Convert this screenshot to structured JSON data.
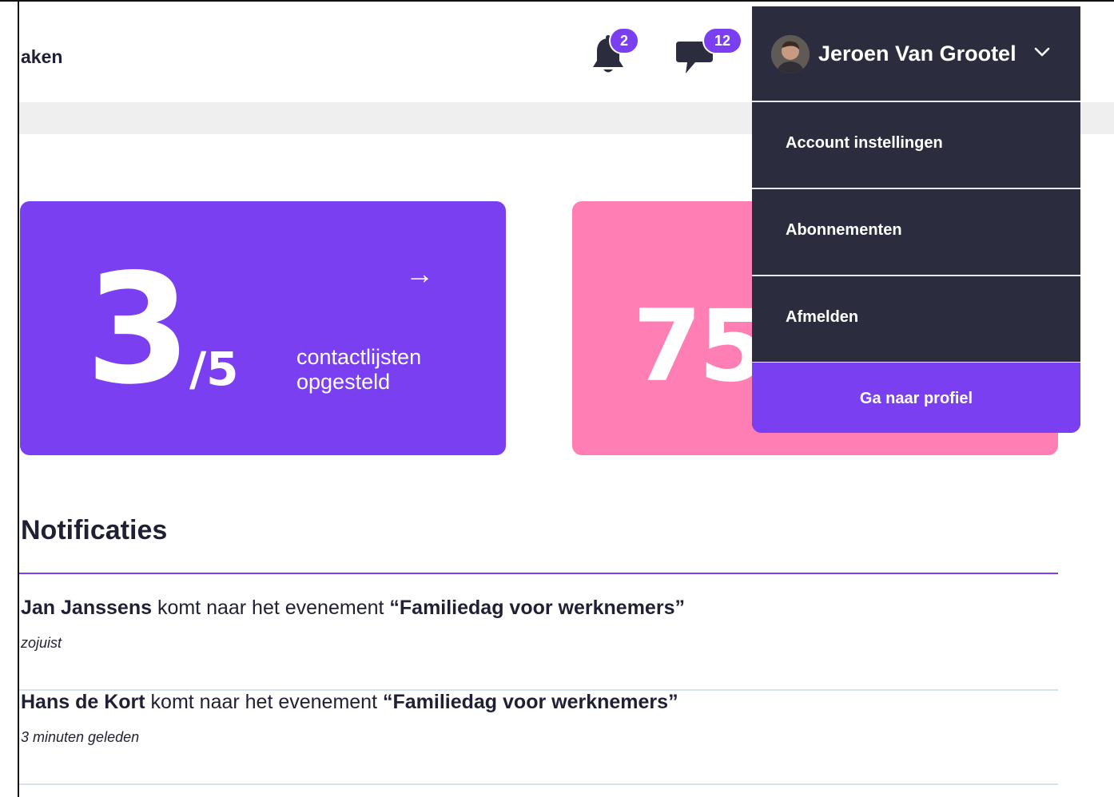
{
  "header": {
    "breadcrumb": "aken",
    "notifications": {
      "icon": "bell-icon",
      "count": "2"
    },
    "messages": {
      "icon": "chat-bubble-icon",
      "count": "12"
    }
  },
  "user_menu": {
    "user_name": "Jeroen Van Grootel",
    "items": [
      {
        "label": "Account instellingen"
      },
      {
        "label": "Abonnementen"
      },
      {
        "label": "Afmelden"
      }
    ],
    "cta_label": "Ga naar profiel"
  },
  "stats": [
    {
      "value": "3",
      "total": "/5",
      "label_line1": "contactlijsten",
      "label_line2": "opgesteld",
      "color": "#7b3ff2",
      "arrow": "→"
    },
    {
      "value": "75",
      "color": "#ff7fb5"
    }
  ],
  "notifications_section": {
    "title": "Notificaties",
    "items": [
      {
        "name": "Jan Janssens",
        "text": " komt naar het evenement ",
        "event": "“Familiedag voor werknemers”",
        "time": "zojuist"
      },
      {
        "name": "Hans de Kort",
        "text": " komt naar het evenement ",
        "event": "“Familiedag voor werknemers”",
        "time": "3 minuten geleden"
      }
    ]
  },
  "colors": {
    "accent": "#7b3ff2",
    "pink": "#ff7fb5",
    "menu_bg": "#2b2d3e",
    "divider": "#d6e2f1"
  }
}
